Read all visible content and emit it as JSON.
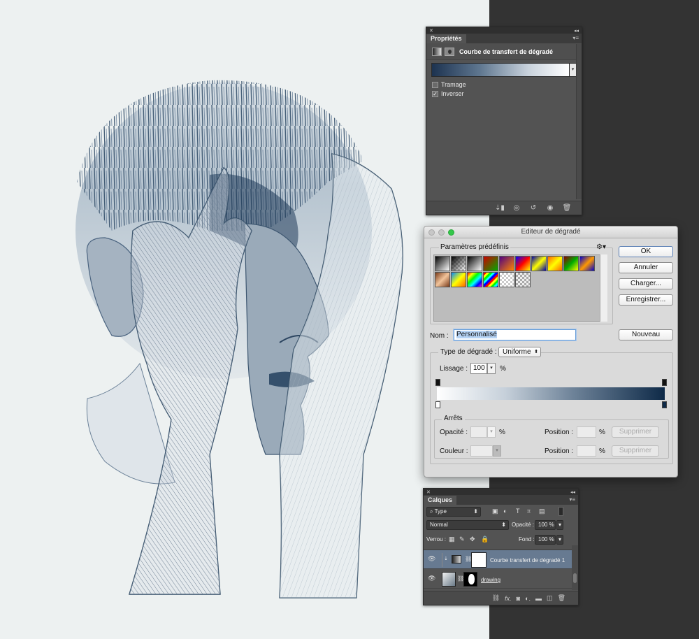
{
  "properties": {
    "tab": "Propriétés",
    "header_title": "Courbe de transfert de dégradé",
    "dither_label": "Tramage",
    "dither_checked": false,
    "reverse_label": "Inverser",
    "reverse_checked": true,
    "footer_icons": [
      "clip-to-layer-icon",
      "view-previous-icon",
      "reset-icon",
      "visibility-icon",
      "delete-icon"
    ]
  },
  "gradient_editor": {
    "title": "Editeur de dégradé",
    "presets_label": "Paramètres prédéfinis",
    "ok_label": "OK",
    "cancel_label": "Annuler",
    "load_label": "Charger...",
    "save_label": "Enregistrer...",
    "name_label": "Nom :",
    "name_value": "Personnalisé",
    "new_label": "Nouveau",
    "type_label": "Type de dégradé :",
    "type_value": "Uniforme",
    "smooth_label": "Lissage :",
    "smooth_value": "100",
    "smooth_unit": "%",
    "stops_label": "Arrêts",
    "opacity_label": "Opacité :",
    "color_label": "Couleur :",
    "percent": "%",
    "position_label": "Position :",
    "delete_label": "Supprimer"
  },
  "layers": {
    "tab": "Calques",
    "filter_value": "Type",
    "blend_mode": "Normal",
    "opacity_label": "Opacité :",
    "opacity_value": "100 %",
    "lock_label": "Verrou :",
    "fill_label": "Fond :",
    "fill_value": "100 %",
    "items": [
      {
        "name": "Courbe transfert de dégradé 1",
        "selected": true
      },
      {
        "name": "drawing",
        "selected": false
      }
    ],
    "footer_icons": [
      "link-icon",
      "fx-icon",
      "mask-icon",
      "adjustment-icon",
      "group-icon",
      "new-layer-icon",
      "trash-icon"
    ]
  }
}
